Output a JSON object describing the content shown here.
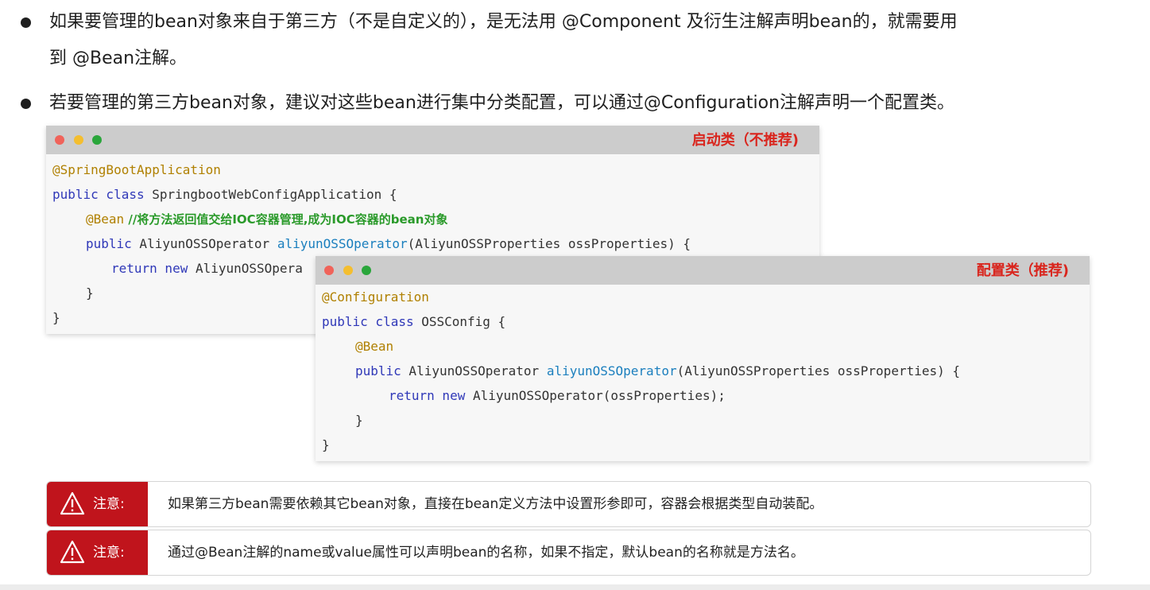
{
  "bullets": [
    {
      "line1": "如果要管理的bean对象来自于第三方（不是自定义的），是无法用 @Component 及衍生注解声明bean的，就需要用",
      "line2": "到 @Bean注解。"
    },
    {
      "line1": "若要管理的第三方bean对象，建议对这些bean进行集中分类配置，可以通过@Configuration注解声明一个配置类。"
    }
  ],
  "window_startup": {
    "tag": "启动类（不推荐)",
    "l1": "@SpringBootApplication",
    "l2_kw": "public class",
    "l2_rest": " SpringbootWebConfigApplication {",
    "l3_ann": "@Bean",
    "l3_comment": " //将方法返回值交给IOC容器管理,成为IOC容器的bean对象",
    "l4_kw": "public",
    "l4_type": " AliyunOSSOperator ",
    "l4_fn": "aliyunOSSOperator",
    "l4_rest": "(AliyunOSSProperties ossProperties) {",
    "l5_kw": "return new",
    "l5_rest": " AliyunOSSOpera",
    "l6": "}",
    "l7": "}"
  },
  "window_config": {
    "tag": "配置类（推荐)",
    "l1": "@Configuration",
    "l2_kw": "public class",
    "l2_rest": " OSSConfig {",
    "l3_ann": "@Bean",
    "l4_kw": "public",
    "l4_type": " AliyunOSSOperator ",
    "l4_fn": "aliyunOSSOperator",
    "l4_rest": "(AliyunOSSProperties ossProperties) {",
    "l5_kw": "return new",
    "l5_rest": " AliyunOSSOperator(ossProperties);",
    "l6": "}",
    "l7": "}"
  },
  "notes": [
    {
      "label": "注意:",
      "text": "如果第三方bean需要依赖其它bean对象，直接在bean定义方法中设置形参即可，容器会根据类型自动装配。"
    },
    {
      "label": "注意:",
      "text": "通过@Bean注解的name或value属性可以声明bean的名称，如果不指定，默认bean的名称就是方法名。"
    }
  ],
  "colors": {
    "traffic_red": "#f0635a",
    "traffic_yellow": "#f4be2f",
    "traffic_green": "#2aa63b",
    "accent_red": "#d9251d"
  }
}
